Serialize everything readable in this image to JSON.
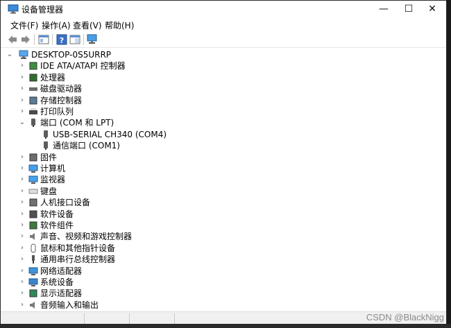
{
  "window": {
    "title": "设备管理器"
  },
  "menu": [
    {
      "label": "文件(F)"
    },
    {
      "label": "操作(A)"
    },
    {
      "label": "查看(V)"
    },
    {
      "label": "帮助(H)"
    }
  ],
  "tree": {
    "root": "DESKTOP-0S5URRP",
    "items": [
      {
        "label": "IDE ATA/ATAPI 控制器",
        "icon": "ide-controller-icon",
        "expanded": false
      },
      {
        "label": "处理器",
        "icon": "processor-icon",
        "expanded": false
      },
      {
        "label": "磁盘驱动器",
        "icon": "disk-drive-icon",
        "expanded": false
      },
      {
        "label": "存储控制器",
        "icon": "storage-controller-icon",
        "expanded": false
      },
      {
        "label": "打印队列",
        "icon": "printer-icon",
        "expanded": false
      },
      {
        "label": "端口 (COM 和 LPT)",
        "icon": "port-icon",
        "expanded": true,
        "children": [
          {
            "label": "USB-SERIAL CH340 (COM4)",
            "icon": "port-icon"
          },
          {
            "label": "通信端口 (COM1)",
            "icon": "port-icon"
          }
        ]
      },
      {
        "label": "固件",
        "icon": "firmware-icon",
        "expanded": false
      },
      {
        "label": "计算机",
        "icon": "computer-icon",
        "expanded": false
      },
      {
        "label": "监视器",
        "icon": "monitor-icon",
        "expanded": false
      },
      {
        "label": "键盘",
        "icon": "keyboard-icon",
        "expanded": false
      },
      {
        "label": "人机接口设备",
        "icon": "hid-icon",
        "expanded": false
      },
      {
        "label": "软件设备",
        "icon": "software-device-icon",
        "expanded": false
      },
      {
        "label": "软件组件",
        "icon": "software-component-icon",
        "expanded": false
      },
      {
        "label": "声音、视频和游戏控制器",
        "icon": "audio-icon",
        "expanded": false
      },
      {
        "label": "鼠标和其他指针设备",
        "icon": "mouse-icon",
        "expanded": false
      },
      {
        "label": "通用串行总线控制器",
        "icon": "usb-icon",
        "expanded": false
      },
      {
        "label": "网络适配器",
        "icon": "network-adapter-icon",
        "expanded": false
      },
      {
        "label": "系统设备",
        "icon": "system-device-icon",
        "expanded": false
      },
      {
        "label": "显示适配器",
        "icon": "display-adapter-icon",
        "expanded": false
      },
      {
        "label": "音频输入和输出",
        "icon": "audio-io-icon",
        "expanded": false
      }
    ]
  },
  "watermark": "CSDN @BlackNigg"
}
